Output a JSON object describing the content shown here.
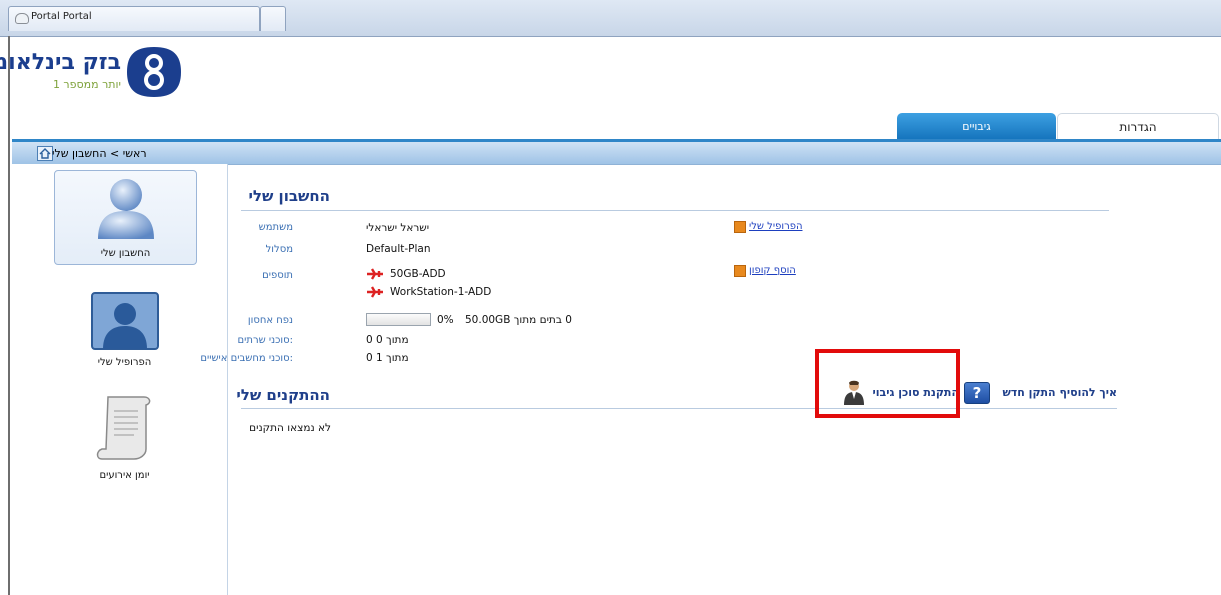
{
  "browser": {
    "tab_title": "Portal Portal"
  },
  "brand": {
    "name": "בזק בינלאומי",
    "slogan": "יותר ממספר 1"
  },
  "top_tabs": {
    "backups": "גיבויים",
    "settings": "הגדרות"
  },
  "breadcrumb": "ראשי > החשבון שלי",
  "sidebar": {
    "items": [
      {
        "label": "החשבון שלי"
      },
      {
        "label": "הפרופיל שלי"
      },
      {
        "label": "יומן אירועים"
      }
    ]
  },
  "account": {
    "title": "החשבון שלי",
    "user_label": "משתמש",
    "user_value": "ישראל ישראלי",
    "plan_label": "מסלול",
    "plan_value": "Default-Plan",
    "addons_label": "תוספים",
    "addons": [
      "50GB-ADD",
      "WorkStation-1-ADD"
    ],
    "storage_label": "נפח אחסון",
    "storage_text": "0 בתים מתוך 50.00GB",
    "storage_percent": "0%",
    "storage_fraction": 0,
    "server_agents_label": ":סוכני שרתים",
    "server_agents_value": "מתוך 0 0",
    "pc_agents_label": ":סוכני מחשבים אישיים",
    "pc_agents_value": "מתוך 1 0",
    "link_profile": "הפרופיל שלי",
    "link_coupon": "הוסף קופון"
  },
  "devices": {
    "title": "ההתקנים שלי",
    "empty_text": "לא נמצאו התקנים",
    "how_to_add": "איך להוסיף התקן חדש",
    "install_agent": "התקנת סוכן גיבוי"
  },
  "colors": {
    "accent": "#1f3f8a",
    "tab_active": "#1473bc",
    "highlight": "#e20b0b",
    "link_icon": "#e8891e"
  },
  "icons": [
    "cloud-icon",
    "home-icon",
    "user-avatar-icon",
    "profile-icon",
    "scroll-icon",
    "plane-icon",
    "help-icon",
    "agent-icon"
  ]
}
